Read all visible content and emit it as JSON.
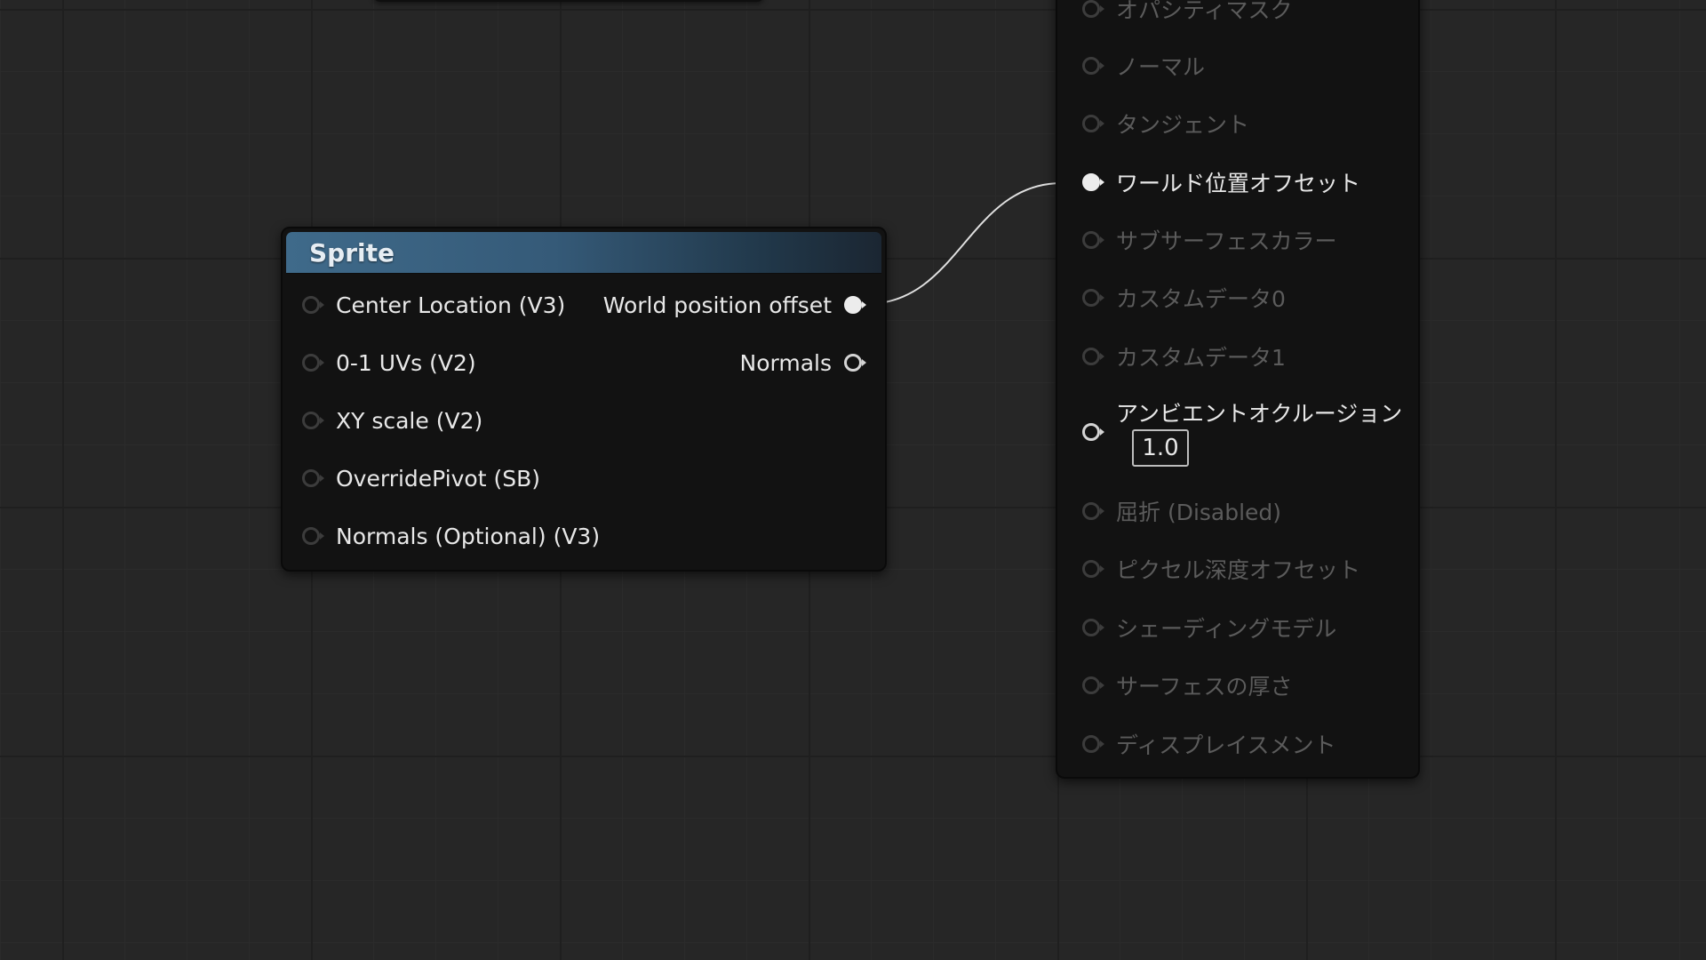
{
  "sprite_node": {
    "title": "Sprite",
    "inputs": [
      {
        "label": "Center Location (V3)"
      },
      {
        "label": "0-1 UVs (V2)"
      },
      {
        "label": "XY scale (V2)"
      },
      {
        "label": "OverridePivot (SB)"
      },
      {
        "label": "Normals (Optional) (V3)"
      }
    ],
    "outputs": [
      {
        "label": "World position offset"
      },
      {
        "label": "Normals"
      }
    ]
  },
  "material_node": {
    "inputs": [
      {
        "label": "オパシティマスク"
      },
      {
        "label": "ノーマル"
      },
      {
        "label": "タンジェント"
      },
      {
        "label": "ワールド位置オフセット"
      },
      {
        "label": "サブサーフェスカラー"
      },
      {
        "label": "カスタムデータ0"
      },
      {
        "label": "カスタムデータ1"
      },
      {
        "label": "アンビエントオクルージョン"
      },
      {
        "label": "屈折 (Disabled)"
      },
      {
        "label": "ピクセル深度オフセット"
      },
      {
        "label": "シェーディングモデル"
      },
      {
        "label": "サーフェスの厚さ"
      },
      {
        "label": "ディスプレイスメント"
      }
    ],
    "ambient_occlusion_value": "1.0"
  },
  "colors": {
    "canvas_background": "#262626",
    "node_body": "#121212",
    "header_accent": "#3f6a8a",
    "wire": "#e0e0e0",
    "active_text": "#e8e8e8",
    "inactive_text": "#5b5b5b"
  }
}
